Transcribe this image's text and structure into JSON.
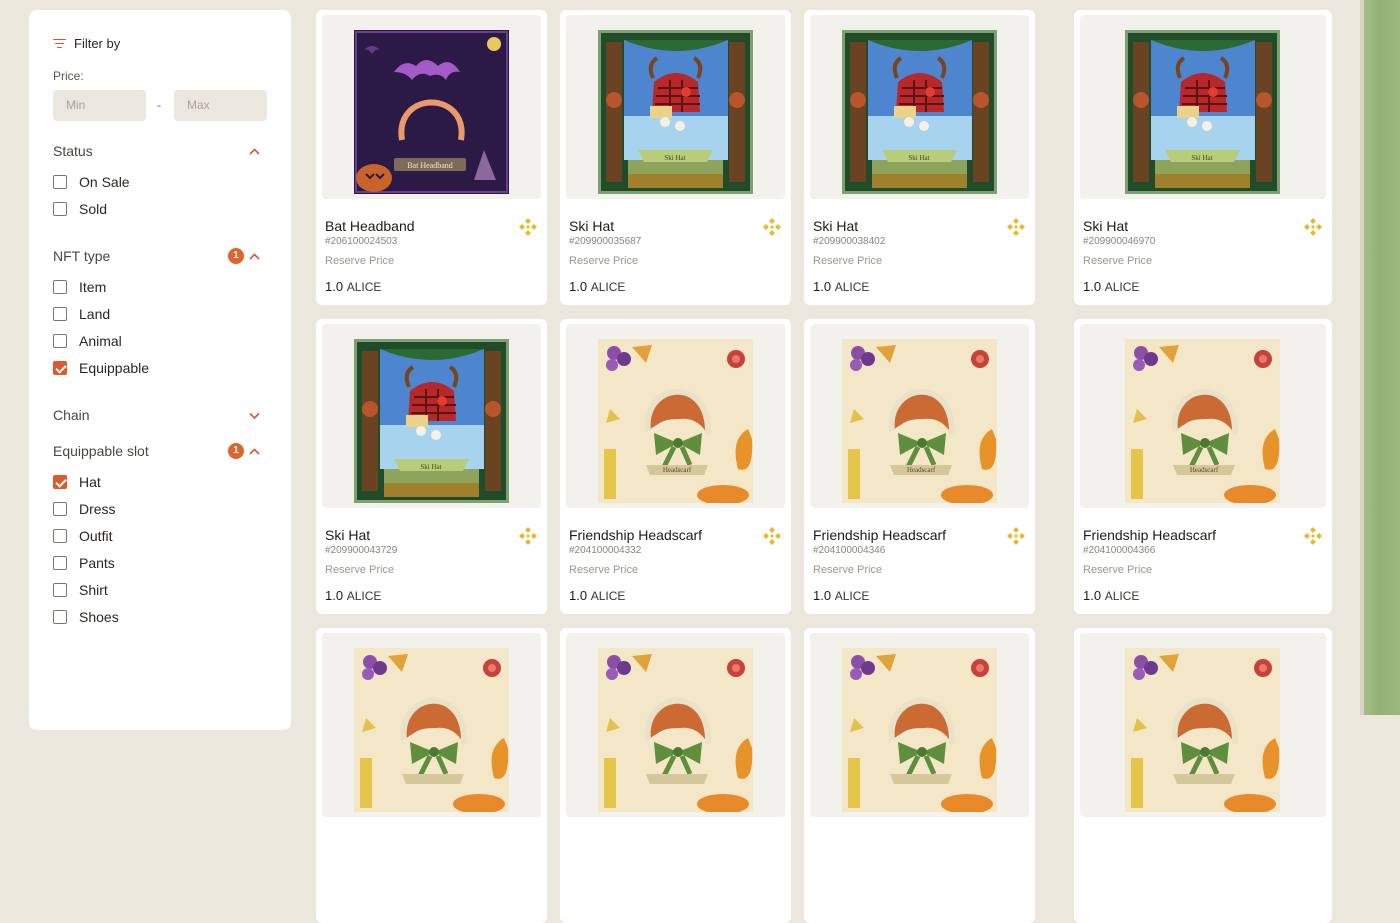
{
  "sidebar": {
    "filter_label": "Filter by",
    "price": {
      "label": "Price:",
      "min_placeholder": "Min",
      "max_placeholder": "Max",
      "separator": "-"
    },
    "status": {
      "title": "Status",
      "expanded": true,
      "options": [
        {
          "label": "On Sale",
          "checked": false
        },
        {
          "label": "Sold",
          "checked": false
        }
      ]
    },
    "nft_type": {
      "title": "NFT type",
      "badge": "1",
      "expanded": true,
      "options": [
        {
          "label": "Item",
          "checked": false
        },
        {
          "label": "Land",
          "checked": false
        },
        {
          "label": "Animal",
          "checked": false
        },
        {
          "label": "Equippable",
          "checked": true
        }
      ]
    },
    "chain": {
      "title": "Chain",
      "expanded": false
    },
    "equippable_slot": {
      "title": "Equippable slot",
      "badge": "1",
      "expanded": true,
      "options": [
        {
          "label": "Hat",
          "checked": true
        },
        {
          "label": "Dress",
          "checked": false
        },
        {
          "label": "Outfit",
          "checked": false
        },
        {
          "label": "Pants",
          "checked": false
        },
        {
          "label": "Shirt",
          "checked": false
        },
        {
          "label": "Shoes",
          "checked": false
        }
      ]
    }
  },
  "cards": [
    {
      "name": "Bat Headband",
      "token": "#206100024503",
      "reserve": "Reserve Price",
      "price": "1.0",
      "currency": "ALICE",
      "art": "bat-headband",
      "art_caption": "Bat Headband"
    },
    {
      "name": "Ski Hat",
      "token": "#209900035687",
      "reserve": "Reserve Price",
      "price": "1.0",
      "currency": "ALICE",
      "art": "ski-hat",
      "art_caption": "Ski Hat"
    },
    {
      "name": "Ski Hat",
      "token": "#209900038402",
      "reserve": "Reserve Price",
      "price": "1.0",
      "currency": "ALICE",
      "art": "ski-hat",
      "art_caption": "Ski Hat"
    },
    {
      "name": "Ski Hat",
      "token": "#209900046970",
      "reserve": "Reserve Price",
      "price": "1.0",
      "currency": "ALICE",
      "art": "ski-hat",
      "art_caption": "Ski Hat"
    },
    {
      "name": "Ski Hat",
      "token": "#209900043729",
      "reserve": "Reserve Price",
      "price": "1.0",
      "currency": "ALICE",
      "art": "ski-hat",
      "art_caption": "Ski Hat"
    },
    {
      "name": "Friendship Headscarf",
      "token": "#204100004332",
      "reserve": "Reserve Price",
      "price": "1.0",
      "currency": "ALICE",
      "art": "headscarf",
      "art_caption": "Headscarf"
    },
    {
      "name": "Friendship Headscarf",
      "token": "#204100004346",
      "reserve": "Reserve Price",
      "price": "1.0",
      "currency": "ALICE",
      "art": "headscarf",
      "art_caption": "Headscarf"
    },
    {
      "name": "Friendship Headscarf",
      "token": "#204100004366",
      "reserve": "Reserve Price",
      "price": "1.0",
      "currency": "ALICE",
      "art": "headscarf",
      "art_caption": "Headscarf"
    },
    {
      "art": "headscarf"
    },
    {
      "art": "headscarf"
    },
    {
      "art": "headscarf"
    },
    {
      "art": "headscarf"
    }
  ],
  "colors": {
    "accent": "#dc5a2d",
    "bnb": "#e7b92f",
    "page_bg": "#ece7dd"
  },
  "icons": {
    "filter": "filter-icon",
    "chevron_up": "chevron-up-icon",
    "chevron_down": "chevron-down-icon",
    "bnb": "bnb-chain-icon"
  }
}
